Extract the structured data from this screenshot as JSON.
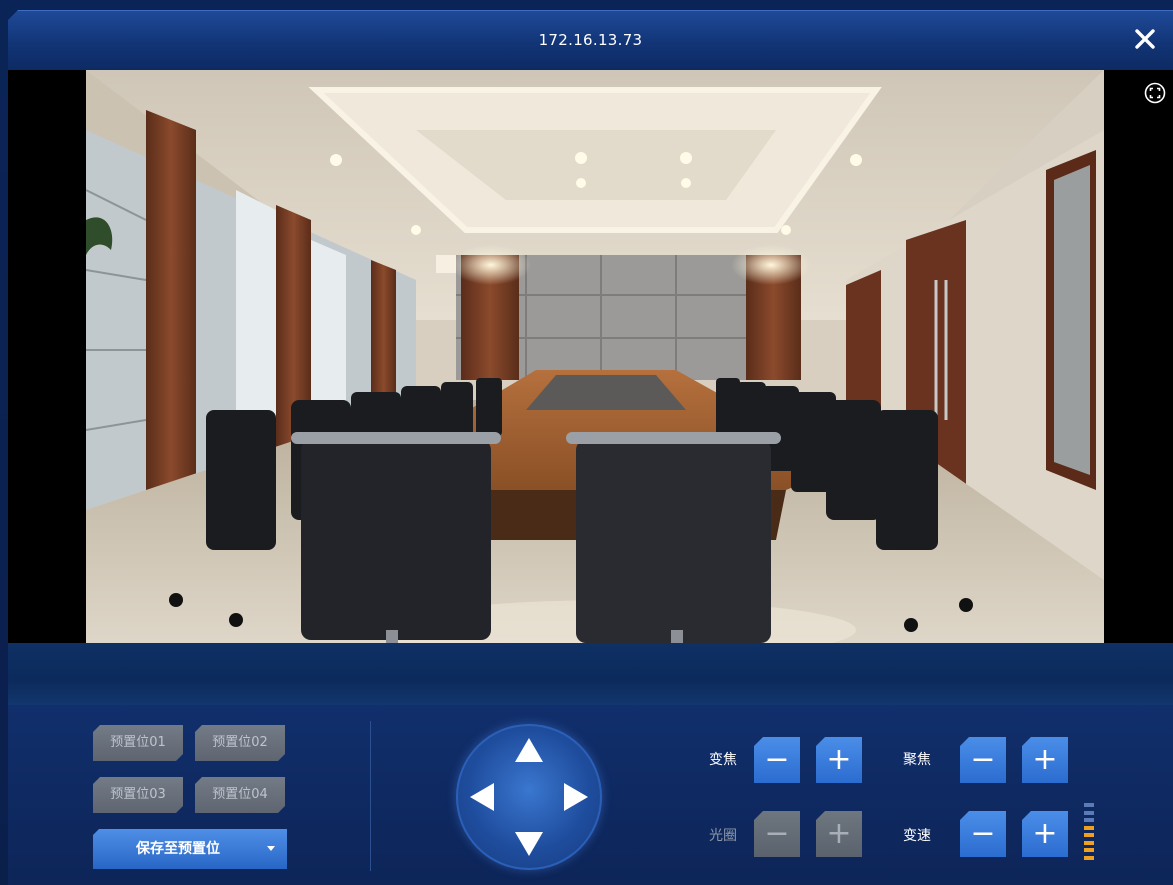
{
  "window": {
    "title": "172.16.13.73"
  },
  "presets": {
    "items": [
      "预置位01",
      "预置位02",
      "预置位03",
      "预置位04"
    ],
    "save_label": "保存至预置位"
  },
  "controls": {
    "zoom_label": "变焦",
    "focus_label": "聚焦",
    "iris_label": "光圈",
    "speed_label": "变速",
    "minus_symbol": "−",
    "plus_symbol": "+"
  },
  "speed_level": {
    "value": 5,
    "max": 8
  },
  "colors": {
    "accent": "#3c7de0",
    "panel": "#0d2558",
    "disabled": "#656d78",
    "speed_on": "#f0a020",
    "speed_off": "#5a7bb8"
  },
  "icons": {
    "close": "close-icon",
    "fullscreen": "fullscreen-icon",
    "ptz_up": "arrow-up-icon",
    "ptz_down": "arrow-down-icon",
    "ptz_left": "arrow-left-icon",
    "ptz_right": "arrow-right-icon"
  }
}
